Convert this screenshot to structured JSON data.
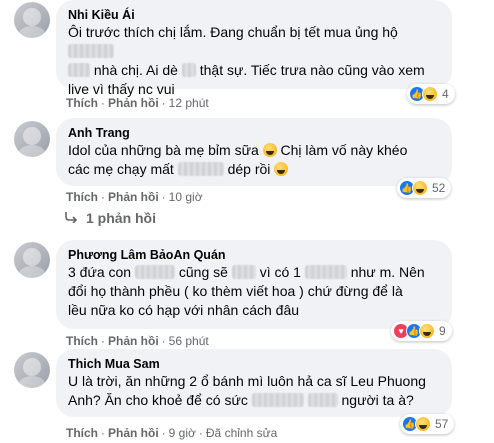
{
  "comments": [
    {
      "author": "Nhi Kiều Ái",
      "lines": [
        [
          "Ôi trước thích chị lắm. Đang chuẩn bị tết mua ủng hộ",
          "BLUR:46"
        ],
        [
          "BLUR:22",
          "nhà chị. Ai dè",
          "BLUR:14",
          "thật sự. Tiếc trưa nào cũng vào xem"
        ],
        [
          "live vì thấy nc vui"
        ]
      ],
      "like": "Thích",
      "reply": "Phản hồi",
      "time": "12 phút",
      "edited": "",
      "reaction_count": "4",
      "reactions": [
        "like",
        "haha"
      ]
    },
    {
      "author": "Anh Trang",
      "lines": [
        [
          "Idol của những bà mẹ bỉm sữa",
          "EMOJI",
          "Chị làm vố này khéo"
        ],
        [
          "các mẹ chạy mất",
          "BLUR:46",
          "dép rồi",
          "EMOJI"
        ]
      ],
      "like": "Thích",
      "reply": "Phản hồi",
      "time": "10 giờ",
      "edited": "",
      "reaction_count": "52",
      "reactions": [
        "like",
        "haha"
      ],
      "replies_label": "1 phản hồi"
    },
    {
      "author": "Phương Lâm BảoAn Quán",
      "lines": [
        [
          "3 đứa con",
          "BLUR:40",
          "cũng sẽ",
          "BLUR:24",
          "vì có 1",
          "BLUR:42",
          "như m. Nên"
        ],
        [
          "đổi họ thành phều ( ko thèm viết hoa ) chứ đừng để là"
        ],
        [
          "lều nữa ko có hạp với nhân cách đâu"
        ]
      ],
      "like": "Thích",
      "reply": "Phản hồi",
      "time": "56 phút",
      "edited": "",
      "reaction_count": "9",
      "reactions": [
        "love",
        "like",
        "haha"
      ]
    },
    {
      "author": "Thich Mua Sam",
      "lines": [
        [
          "U là trời, ăn những 2 ổ bánh mì luôn hả ca sĩ Leu Phuong"
        ],
        [
          "Anh? Ăn cho khoẻ để có sức",
          "BLUR:52",
          "BLUR:30",
          "người ta à?"
        ]
      ],
      "like": "Thích",
      "reply": "Phản hồi",
      "time": "9 giờ",
      "edited": "Đã chỉnh sửa",
      "reaction_count": "57",
      "reactions": [
        "like",
        "haha"
      ]
    }
  ],
  "icons": {
    "like": "thumbs-up-icon",
    "haha": "laughing-face-icon",
    "love": "heart-icon",
    "reply_arrow": "reply-arrow-icon"
  },
  "colors": {
    "bubble": "#f0f2f5",
    "meta_text": "#65676b",
    "like_blue": "#1877f2",
    "love_red": "#f33e58",
    "haha_yellow": "#f7b928"
  }
}
